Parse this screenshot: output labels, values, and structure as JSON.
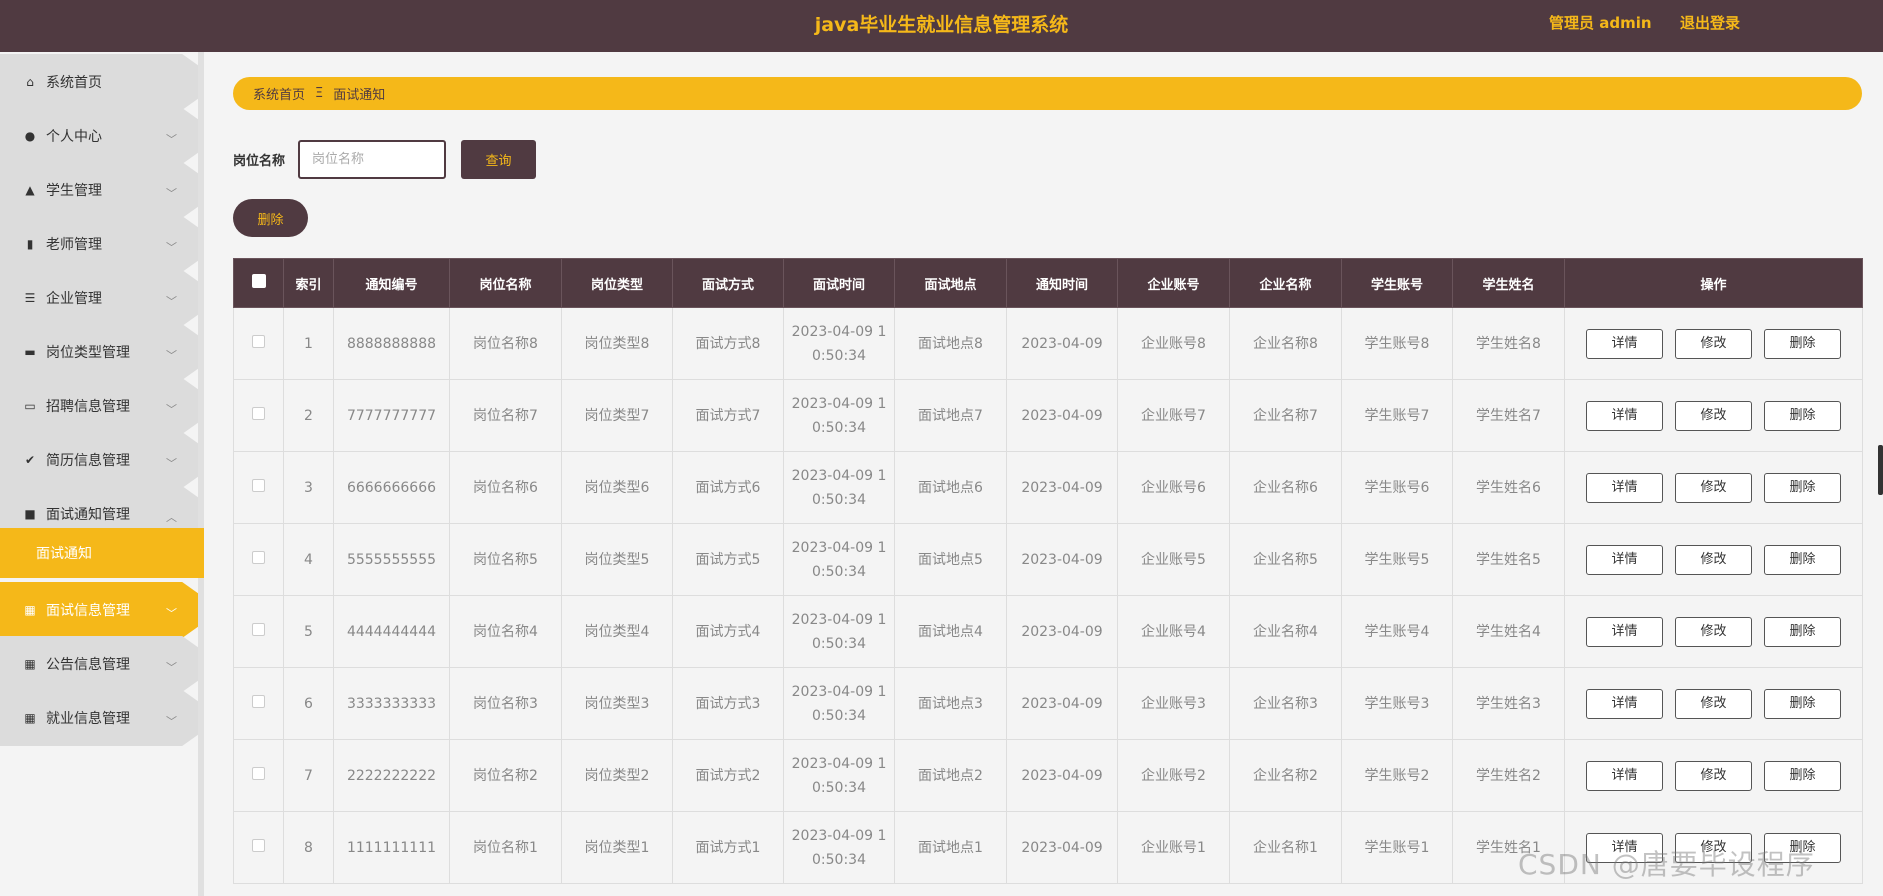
{
  "header": {
    "title": "java毕业生就业信息管理系统",
    "admin_label": "管理员 admin",
    "logout_label": "退出登录"
  },
  "sidebar": {
    "items": [
      {
        "label": "系统首页",
        "icon": "home-icon"
      },
      {
        "label": "个人中心",
        "icon": "user-icon"
      },
      {
        "label": "学生管理",
        "icon": "chart-icon"
      },
      {
        "label": "老师管理",
        "icon": "library-icon"
      },
      {
        "label": "企业管理",
        "icon": "list-icon"
      },
      {
        "label": "岗位类型管理",
        "icon": "message-icon"
      },
      {
        "label": "招聘信息管理",
        "icon": "monitor-icon"
      },
      {
        "label": "简历信息管理",
        "icon": "clipboard-icon"
      },
      {
        "label": "面试通知管理",
        "icon": "briefcase-icon"
      },
      {
        "label": "面试信息管理",
        "icon": "grid-icon"
      },
      {
        "label": "公告信息管理",
        "icon": "grid-icon"
      },
      {
        "label": "就业信息管理",
        "icon": "grid-icon"
      }
    ],
    "submenu": {
      "label": "面试通知"
    }
  },
  "breadcrumb": {
    "home": "系统首页",
    "separator": "Ξ",
    "current": "面试通知"
  },
  "search": {
    "label": "岗位名称",
    "placeholder": "岗位名称",
    "button": "查询"
  },
  "bulk_delete": "删除",
  "table": {
    "headers": [
      "索引",
      "通知编号",
      "岗位名称",
      "岗位类型",
      "面试方式",
      "面试时间",
      "面试地点",
      "通知时间",
      "企业账号",
      "企业名称",
      "学生账号",
      "学生姓名",
      "操作"
    ],
    "actions": {
      "detail": "详情",
      "edit": "修改",
      "delete": "删除"
    },
    "rows": [
      {
        "index": "1",
        "notice_no": "8888888888",
        "job_name": "岗位名称8",
        "job_type": "岗位类型8",
        "method": "面试方式8",
        "time1": "2023-04-09 1",
        "time2": "0:50:34",
        "location": "面试地点8",
        "notice_time": "2023-04-09",
        "company_account": "企业账号8",
        "company_name": "企业名称8",
        "student_account": "学生账号8",
        "student_name": "学生姓名8"
      },
      {
        "index": "2",
        "notice_no": "7777777777",
        "job_name": "岗位名称7",
        "job_type": "岗位类型7",
        "method": "面试方式7",
        "time1": "2023-04-09 1",
        "time2": "0:50:34",
        "location": "面试地点7",
        "notice_time": "2023-04-09",
        "company_account": "企业账号7",
        "company_name": "企业名称7",
        "student_account": "学生账号7",
        "student_name": "学生姓名7"
      },
      {
        "index": "3",
        "notice_no": "6666666666",
        "job_name": "岗位名称6",
        "job_type": "岗位类型6",
        "method": "面试方式6",
        "time1": "2023-04-09 1",
        "time2": "0:50:34",
        "location": "面试地点6",
        "notice_time": "2023-04-09",
        "company_account": "企业账号6",
        "company_name": "企业名称6",
        "student_account": "学生账号6",
        "student_name": "学生姓名6"
      },
      {
        "index": "4",
        "notice_no": "5555555555",
        "job_name": "岗位名称5",
        "job_type": "岗位类型5",
        "method": "面试方式5",
        "time1": "2023-04-09 1",
        "time2": "0:50:34",
        "location": "面试地点5",
        "notice_time": "2023-04-09",
        "company_account": "企业账号5",
        "company_name": "企业名称5",
        "student_account": "学生账号5",
        "student_name": "学生姓名5"
      },
      {
        "index": "5",
        "notice_no": "4444444444",
        "job_name": "岗位名称4",
        "job_type": "岗位类型4",
        "method": "面试方式4",
        "time1": "2023-04-09 1",
        "time2": "0:50:34",
        "location": "面试地点4",
        "notice_time": "2023-04-09",
        "company_account": "企业账号4",
        "company_name": "企业名称4",
        "student_account": "学生账号4",
        "student_name": "学生姓名4"
      },
      {
        "index": "6",
        "notice_no": "3333333333",
        "job_name": "岗位名称3",
        "job_type": "岗位类型3",
        "method": "面试方式3",
        "time1": "2023-04-09 1",
        "time2": "0:50:34",
        "location": "面试地点3",
        "notice_time": "2023-04-09",
        "company_account": "企业账号3",
        "company_name": "企业名称3",
        "student_account": "学生账号3",
        "student_name": "学生姓名3"
      },
      {
        "index": "7",
        "notice_no": "2222222222",
        "job_name": "岗位名称2",
        "job_type": "岗位类型2",
        "method": "面试方式2",
        "time1": "2023-04-09 1",
        "time2": "0:50:34",
        "location": "面试地点2",
        "notice_time": "2023-04-09",
        "company_account": "企业账号2",
        "company_name": "企业名称2",
        "student_account": "学生账号2",
        "student_name": "学生姓名2"
      },
      {
        "index": "8",
        "notice_no": "1111111111",
        "job_name": "岗位名称1",
        "job_type": "岗位类型1",
        "method": "面试方式1",
        "time1": "2023-04-09 1",
        "time2": "0:50:34",
        "location": "面试地点1",
        "notice_time": "2023-04-09",
        "company_account": "企业账号1",
        "company_name": "企业名称1",
        "student_account": "学生账号1",
        "student_name": "学生姓名1"
      }
    ]
  },
  "watermark": "CSDN @唐要毕设程序",
  "colors": {
    "header_bg": "#503a41",
    "accent": "#f5b819",
    "menu_bg": "#dcdcdc"
  }
}
